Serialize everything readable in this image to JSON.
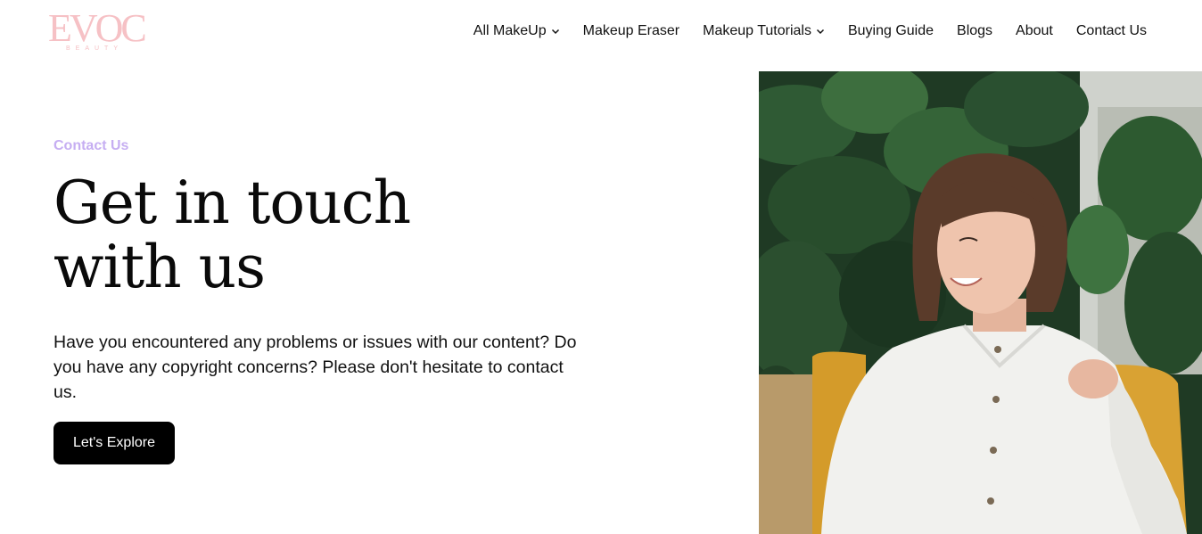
{
  "brand": {
    "logo_text": "EVOC",
    "logo_sub": "BEAUTY"
  },
  "nav": {
    "items": [
      {
        "label": "All MakeUp",
        "dropdown": true
      },
      {
        "label": "Makeup Eraser",
        "dropdown": false
      },
      {
        "label": "Makeup Tutorials",
        "dropdown": true
      },
      {
        "label": "Buying Guide",
        "dropdown": false
      },
      {
        "label": "Blogs",
        "dropdown": false
      },
      {
        "label": "About",
        "dropdown": false
      },
      {
        "label": "Contact Us",
        "dropdown": false
      }
    ]
  },
  "hero": {
    "eyebrow": "Contact Us",
    "headline_line1": "Get in touch",
    "headline_line2": "with us",
    "lede": "Have you encountered any problems or issues with our content? Do you have any copyright concerns? Please don't hesitate to contact us.",
    "cta_label": "Let's Explore"
  },
  "colors": {
    "logo": "#f6c1c5",
    "eyebrow": "#c6aef2",
    "cta_bg": "#000000",
    "cta_text": "#ffffff"
  },
  "icons": {
    "dropdown": "chevron-down-icon"
  }
}
